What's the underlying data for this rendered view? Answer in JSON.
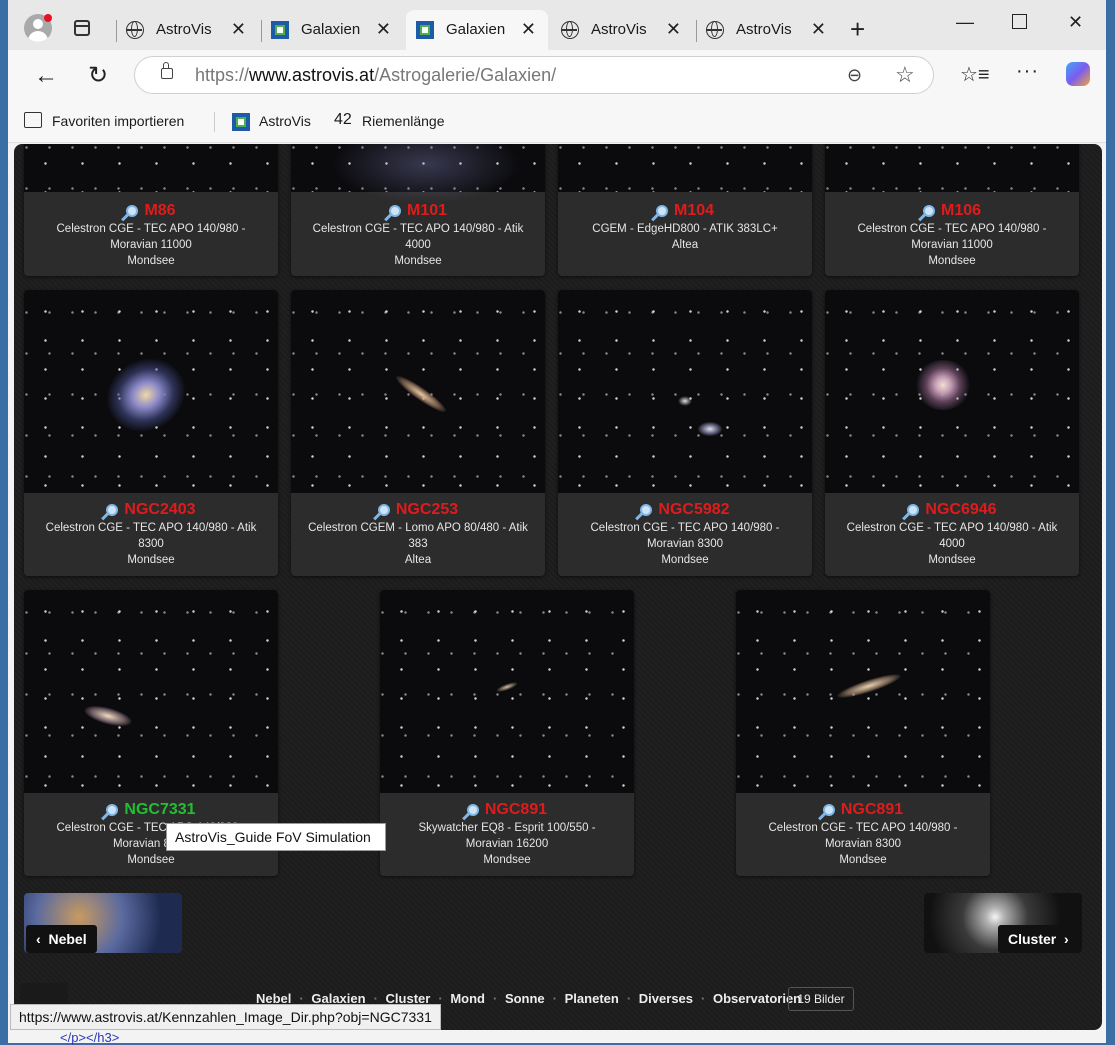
{
  "browser": {
    "tabs": [
      {
        "label": "AstroVis",
        "icon": "globe-icon",
        "active": false
      },
      {
        "label": "Galaxien",
        "icon": "astrovis-logo-icon",
        "active": false
      },
      {
        "label": "Galaxien",
        "icon": "astrovis-logo-icon",
        "active": true
      },
      {
        "label": "AstroVis",
        "icon": "globe-icon",
        "active": false
      },
      {
        "label": "AstroVis",
        "icon": "globe-icon",
        "active": false
      }
    ],
    "close_glyph": "✕",
    "new_tab_glyph": "+",
    "url_prefix": "https://",
    "url_host": "www.astrovis.at",
    "url_path": "/Astrogalerie/Galaxien/",
    "bookmarks": {
      "import": "Favoriten importieren",
      "astrovis": "AstroVis",
      "riemen": "Riemenlänge",
      "riemen_icon_text": "42"
    }
  },
  "gallery": {
    "cards": [
      {
        "title": "M86",
        "desc1": "Celestron CGE - TEC APO 140/980 -",
        "desc2": "Moravian 11000",
        "location": "Mondsee",
        "color": "red"
      },
      {
        "title": "M101",
        "desc1": "Celestron CGE - TEC APO 140/980 - Atik",
        "desc2": "4000",
        "location": "Mondsee",
        "color": "red"
      },
      {
        "title": "M104",
        "desc1": "CGEM - EdgeHD800 - ATIK 383LC+",
        "desc2": "Altea",
        "location": "",
        "color": "red"
      },
      {
        "title": "M106",
        "desc1": "Celestron CGE - TEC APO 140/980 -",
        "desc2": "Moravian 11000",
        "location": "Mondsee",
        "color": "red"
      },
      {
        "title": "NGC2403",
        "desc1": "Celestron CGE - TEC APO 140/980 - Atik",
        "desc2": "8300",
        "location": "Mondsee",
        "color": "red"
      },
      {
        "title": "NGC253",
        "desc1": "Celestron CGEM - Lomo APO 80/480 - Atik",
        "desc2": "383",
        "location": "Altea",
        "color": "red"
      },
      {
        "title": "NGC5982",
        "desc1": "Celestron CGE - TEC APO 140/980 -",
        "desc2": "Moravian 8300",
        "location": "Mondsee",
        "color": "red"
      },
      {
        "title": "NGC6946",
        "desc1": "Celestron CGE - TEC APO 140/980 - Atik",
        "desc2": "4000",
        "location": "Mondsee",
        "color": "red"
      },
      {
        "title": "NGC7331",
        "desc1": "Celestron CGE - TEC APO 140/980 -",
        "desc2": "Moravian 8300",
        "location": "Mondsee",
        "color": "green"
      },
      {
        "title": "NGC891",
        "desc1": "Skywatcher EQ8 - Esprit 100/550 -",
        "desc2": "Moravian 16200",
        "location": "Mondsee",
        "color": "red"
      },
      {
        "title": "NGC891",
        "desc1": "Celestron CGE - TEC APO 140/980 -",
        "desc2": "Moravian 8300",
        "location": "Mondsee",
        "color": "red"
      }
    ],
    "tooltip": "AstroVis_Guide FoV Simulation",
    "prev_label": "Nebel",
    "next_label": "Cluster",
    "footer_links": [
      "Nebel",
      "Galaxien",
      "Cluster",
      "Mond",
      "Sonne",
      "Planeten",
      "Diverses",
      "Observatorien"
    ],
    "image_count": "19 Bilder"
  },
  "status_url": "https://www.astrovis.at/Kennzahlen_Image_Dir.php?obj=NGC7331",
  "background_code": "</p></h3>",
  "colors": {
    "title_red": "#e01b1b",
    "title_green": "#20c030"
  }
}
